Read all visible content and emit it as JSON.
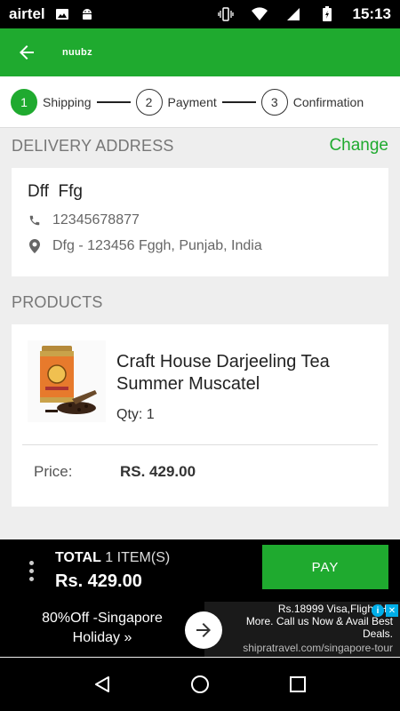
{
  "status_bar": {
    "carrier": "airtel",
    "time": "15:13"
  },
  "app_bar": {
    "title": "nuubz"
  },
  "stepper": {
    "steps": [
      {
        "number": "1",
        "label": "Shipping",
        "active": true
      },
      {
        "number": "2",
        "label": "Payment",
        "active": false
      },
      {
        "number": "3",
        "label": "Confirmation",
        "active": false
      }
    ]
  },
  "delivery": {
    "header": "DELIVERY ADDRESS",
    "change_label": "Change",
    "name": "Dff  Ffg",
    "phone": "12345678877",
    "address": "Dfg - 123456 Fggh, Punjab, India"
  },
  "products": {
    "header": "PRODUCTS",
    "items": [
      {
        "title": "Craft House Darjeeling Tea Summer Muscatel",
        "qty": "Qty: 1",
        "price_label": "Price:",
        "price": "RS. 429.00"
      }
    ]
  },
  "bottom_bar": {
    "total_label": "TOTAL",
    "items_label": "1 ITEM(S)",
    "total_amount": "Rs. 429.00",
    "pay_label": "PAY"
  },
  "ad": {
    "left_line1": "80%Off -Singapore",
    "left_line2": "Holiday »",
    "right_line1": "Rs.18999 Visa,Flight,Ho",
    "right_line2": "More. Call us Now & Avail Best",
    "right_line3": "Deals.",
    "url": "shipratravel.com/singapore-tour"
  },
  "colors": {
    "accent": "#1faa2f",
    "background": "#eeeeee"
  }
}
